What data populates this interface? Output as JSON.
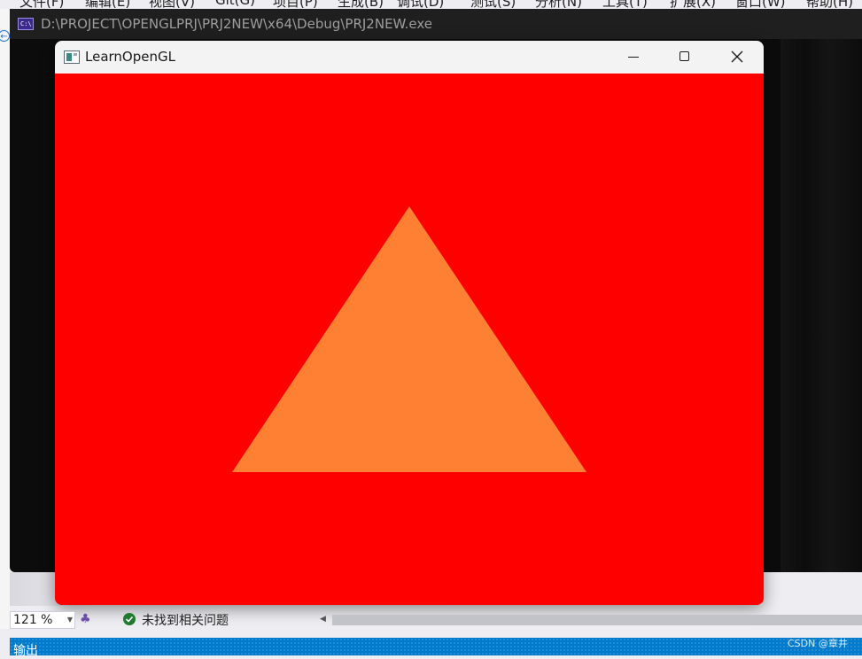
{
  "vs": {
    "menu": [
      "文件(F)",
      "编辑(E)",
      "视图(V)",
      "Git(G)",
      "项目(P)",
      "生成(B)",
      "调试(D)",
      "测试(S)",
      "分析(N)",
      "工具(T)",
      "扩展(X)",
      "窗口(W)",
      "帮助(H)"
    ],
    "zoom": "121 %",
    "status": "未找到相关问题",
    "output_label": "输出",
    "watermark": "CSDN @章井"
  },
  "console": {
    "icon_text": "C:\\",
    "title": "D:\\PROJECT\\OPENGLPRJ\\PRJ2NEW\\x64\\Debug\\PRJ2NEW.exe"
  },
  "gl_window": {
    "title": "LearnOpenGL",
    "clear_color": "#ff0000",
    "triangle_color": "#ff7f33",
    "triangle_vertices_ndc": [
      [
        -0.5,
        -0.5
      ],
      [
        0.5,
        -0.5
      ],
      [
        0.0,
        0.5
      ]
    ]
  },
  "icons": {
    "minimize": "minimize-icon",
    "maximize": "maximize-icon",
    "close": "close-icon",
    "status": "check-circle-icon"
  }
}
